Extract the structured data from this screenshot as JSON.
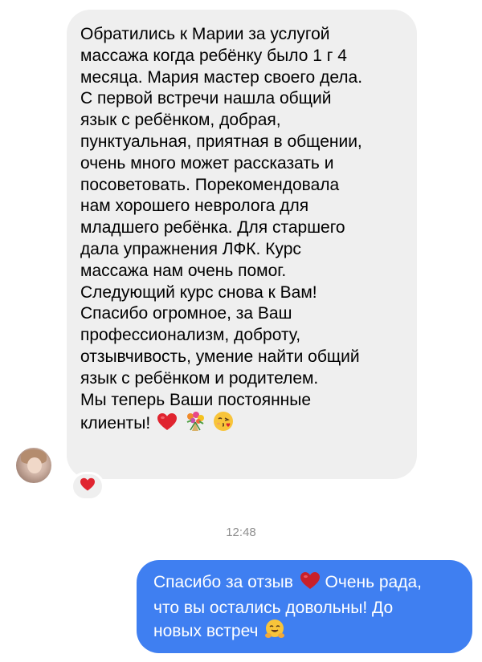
{
  "incoming_message": {
    "lines": [
      "Обратились к Марии за услугой",
      "массажа когда ребёнку было 1 г  4",
      "месяца. Мария мастер своего дела.",
      "С первой встречи нашла общий",
      "язык с ребёнком, добрая,",
      "пунктуальная, приятная в общении,",
      "очень много может рассказать и",
      "посоветовать. Порекомендовала",
      "нам хорошего невролога для",
      "младшего ребёнка. Для старшего",
      "дала упражнения ЛФК. Курс",
      "массажа нам очень помог.",
      "Следующий курс снова к Вам!",
      "Спасибо огромное, за Ваш",
      "профессионализм, доброту,",
      "отзывчивость, умение найти общий",
      "язык с ребёнком и родителем.",
      "Мы теперь Ваши постоянные",
      "клиенты!"
    ],
    "trailing_emojis": [
      "heart-icon",
      "bouquet-icon",
      "kissing-face-icon"
    ],
    "reaction": "heart-icon"
  },
  "timestamp": "12:48",
  "outgoing_message": {
    "line1": "Спасибо за отзыв",
    "line1_after": "Очень рада,",
    "line2": "что вы остались довольны! До",
    "line3": "новых встреч"
  },
  "colors": {
    "incoming_bubble": "#efefef",
    "outgoing_bubble": "#3f7ff1",
    "heart": "#e0242f",
    "timestamp": "#8e8e8e"
  }
}
